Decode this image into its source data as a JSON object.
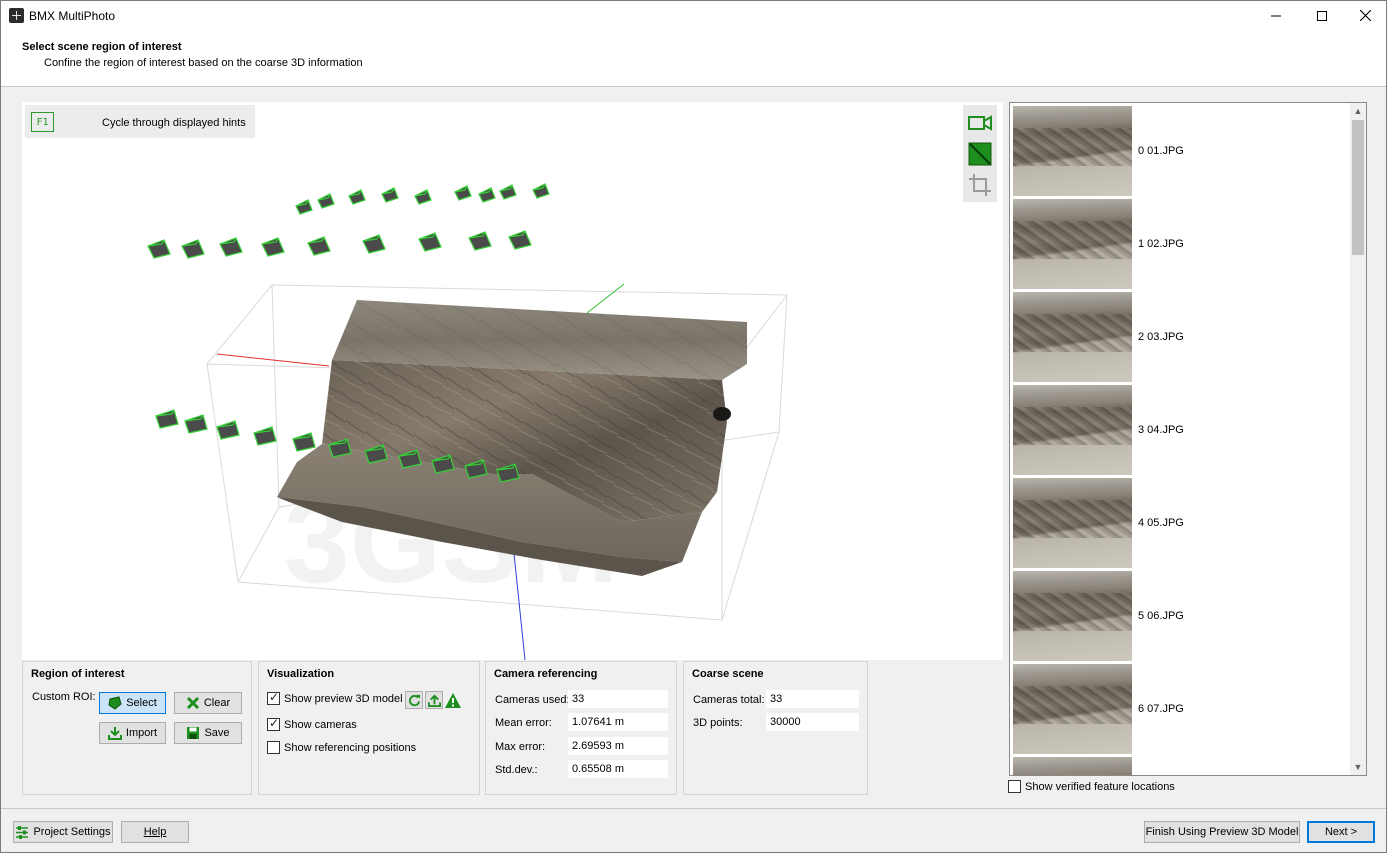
{
  "window": {
    "title": "BMX MultiPhoto"
  },
  "header": {
    "title": "Select scene region of interest",
    "subtitle": "Confine the region of interest based on the coarse 3D information"
  },
  "viewport": {
    "hint_key": "F1",
    "hint_text": "Cycle through displayed hints",
    "watermark": "3GSM",
    "tools": [
      "camera-view-icon",
      "roi-select-icon",
      "crop-icon"
    ]
  },
  "thumbnails": [
    {
      "label": "0 01.JPG"
    },
    {
      "label": "1 02.JPG"
    },
    {
      "label": "2 03.JPG"
    },
    {
      "label": "3 04.JPG"
    },
    {
      "label": "4 05.JPG"
    },
    {
      "label": "5 06.JPG"
    },
    {
      "label": "6 07.JPG"
    }
  ],
  "show_verified": {
    "label": "Show verified feature locations",
    "checked": false
  },
  "roi": {
    "title": "Region of interest",
    "custom_label": "Custom ROI:",
    "select": "Select",
    "clear": "Clear",
    "import": "Import",
    "save": "Save"
  },
  "visualization": {
    "title": "Visualization",
    "preview": {
      "label": "Show preview 3D model",
      "checked": true
    },
    "cameras": {
      "label": "Show cameras",
      "checked": true
    },
    "ref_positions": {
      "label": "Show referencing positions",
      "checked": false
    }
  },
  "camera_ref": {
    "title": "Camera referencing",
    "rows": [
      {
        "label": "Cameras used:",
        "value": "33"
      },
      {
        "label": "Mean error:",
        "value": "1.07641 m"
      },
      {
        "label": "Max error:",
        "value": "2.69593 m"
      },
      {
        "label": "Std.dev.:",
        "value": "0.65508 m"
      }
    ]
  },
  "coarse": {
    "title": "Coarse scene",
    "rows": [
      {
        "label": "Cameras total:",
        "value": "33"
      },
      {
        "label": "3D points:",
        "value": "30000"
      }
    ]
  },
  "footer": {
    "project_settings": "Project Settings",
    "help": "Help",
    "finish": "Finish Using Preview 3D Model",
    "next": "Next >"
  },
  "colors": {
    "accent_green": "#1e8f1e",
    "select_blue": "#0078d7"
  }
}
